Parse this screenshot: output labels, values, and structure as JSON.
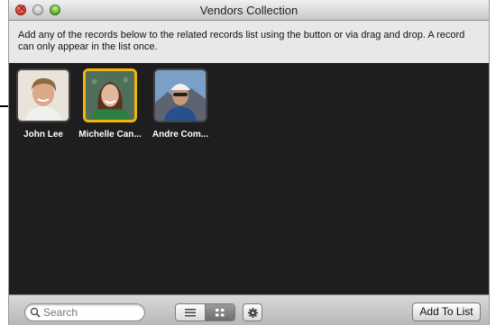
{
  "window": {
    "title": "Vendors Collection",
    "instructions": "Add any of the records below to the related records list using the button or via drag and drop.  A record can only appear in the list once."
  },
  "records": [
    {
      "name": "John Lee",
      "selected": false
    },
    {
      "name": "Michelle Can...",
      "selected": true
    },
    {
      "name": "Andre Com...",
      "selected": false
    }
  ],
  "toolbar": {
    "search_placeholder": "Search",
    "view_list_icon": "list-view-icon",
    "view_grid_icon": "grid-view-icon",
    "view_active": "grid",
    "settings_icon": "gear-icon",
    "add_button_label": "Add To List"
  },
  "colors": {
    "selection_border": "#f2b510",
    "browser_background": "#1e1e1e"
  }
}
